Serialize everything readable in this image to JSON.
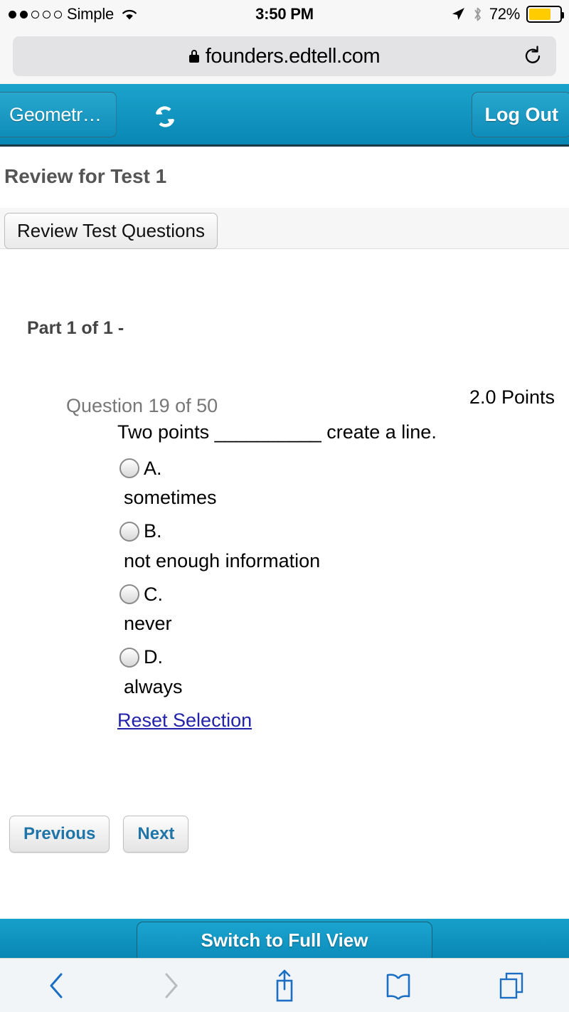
{
  "statusbar": {
    "carrier": "Simple",
    "time": "3:50 PM",
    "battery_percent": "72%",
    "battery_level": 72,
    "signal_bars_filled": 2,
    "signal_bars_total": 5,
    "icons": [
      "wifi-icon",
      "location-arrow-icon",
      "bluetooth-icon",
      "battery-icon"
    ]
  },
  "browser": {
    "url": "founders.edtell.com",
    "secure": true,
    "reload_label": "reload-icon",
    "toolbar": {
      "back": "back-chevron-icon",
      "forward": "forward-chevron-icon",
      "share": "share-icon",
      "bookmarks": "bookmarks-icon",
      "tabs": "tabs-icon"
    }
  },
  "app_header": {
    "back_label": "Geometr…",
    "sync_label": "sync-icon",
    "logout_label": "Log Out"
  },
  "page": {
    "title": "Review for Test 1",
    "tab_label": "Review Test Questions",
    "part_label": "Part 1 of 1 -",
    "question_number": "Question 19 of 50",
    "points": "2.0 Points",
    "question_text": "Two points __________ create a line.",
    "choices": [
      {
        "letter": "A.",
        "text": "sometimes",
        "selected": false
      },
      {
        "letter": "B.",
        "text": "not enough information",
        "selected": false
      },
      {
        "letter": "C.",
        "text": "never",
        "selected": false
      },
      {
        "letter": "D.",
        "text": "always",
        "selected": false
      }
    ],
    "reset_link": "Reset Selection",
    "previous_label": "Previous",
    "next_label": "Next"
  },
  "app_footer": {
    "full_view_label": "Switch to Full View"
  },
  "colors": {
    "app_blue": "#0987b4",
    "app_blue_light": "#1ba3cc",
    "link_blue": "#2222aa",
    "button_text_blue": "#1f74a8",
    "battery_yellow": "#ffcc00",
    "safari_icon_blue": "#1a6fc4"
  }
}
